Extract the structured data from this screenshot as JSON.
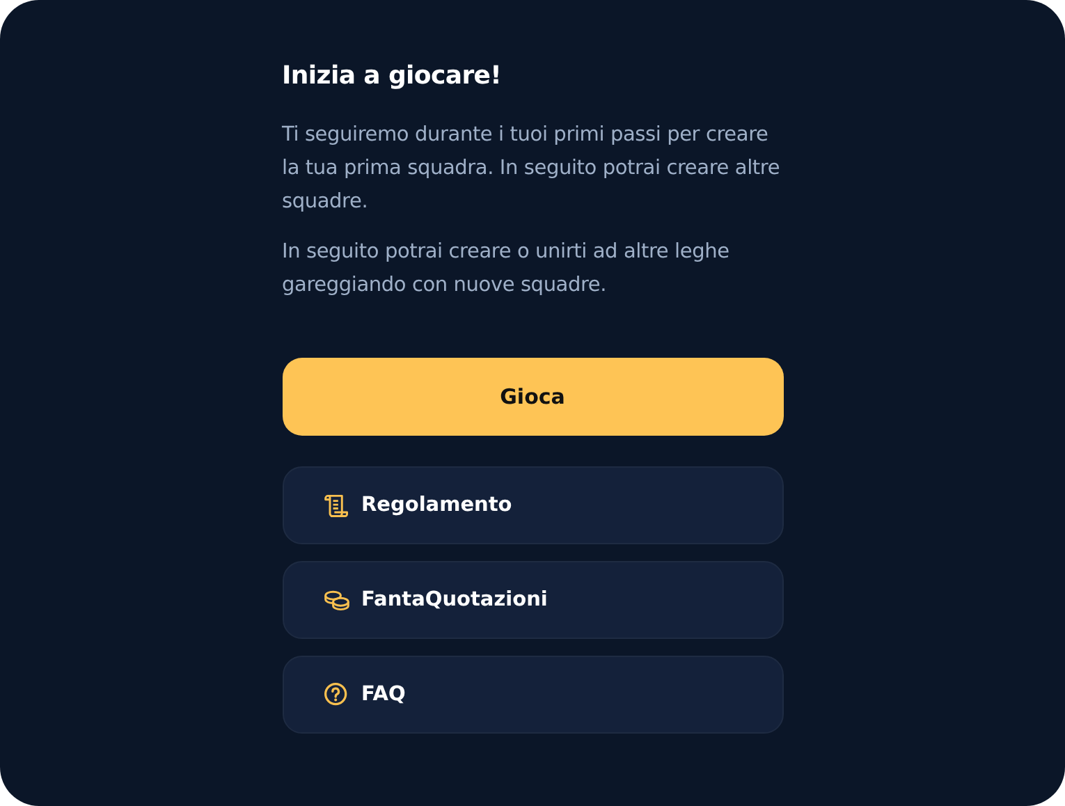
{
  "title": "Inizia a giocare!",
  "paragraphs": [
    "Ti seguiremo durante i tuoi primi passi per creare la tua prima squadra. In seguito potrai creare altre squadre.",
    "In seguito potrai creare o unirti ad altre leghe gareggiando con nuove squadre."
  ],
  "primary_button": "Gioca",
  "links": [
    {
      "label": "Regolamento",
      "kind": "rules"
    },
    {
      "label": "FantaQuotazioni",
      "kind": "coins"
    },
    {
      "label": "FAQ",
      "kind": "help"
    }
  ]
}
